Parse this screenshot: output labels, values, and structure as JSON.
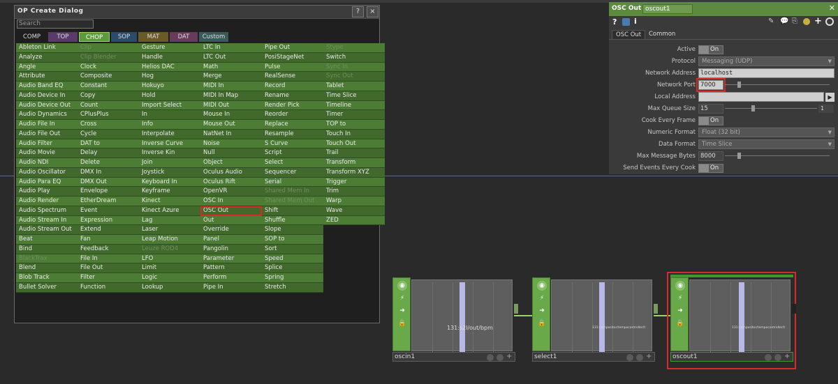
{
  "dialog": {
    "title": "OP Create Dialog",
    "help_label": "?",
    "close_label": "×",
    "search_placeholder": "Search",
    "families": [
      {
        "label": "COMP",
        "color": "#1e1e1e"
      },
      {
        "label": "TOP",
        "color": "#5a3a6a"
      },
      {
        "label": "CHOP",
        "color": "#5c9a3c"
      },
      {
        "label": "SOP",
        "color": "#2c4a6a"
      },
      {
        "label": "MAT",
        "color": "#6a5a28"
      },
      {
        "label": "DAT",
        "color": "#6a3a5a"
      },
      {
        "label": "Custom",
        "color": "#3a5a5a"
      }
    ],
    "selected_family": "CHOP",
    "columns": [
      [
        "Ableton Link",
        "Analyze",
        "Angle",
        "Attribute",
        "Audio Band EQ",
        "Audio Device In",
        "Audio Device Out",
        "Audio Dynamics",
        "Audio File In",
        "Audio File Out",
        "Audio Filter",
        "Audio Movie",
        "Audio NDI",
        "Audio Oscillator",
        "Audio Para EQ",
        "Audio Play",
        "Audio Render",
        "Audio Spectrum",
        "Audio Stream In",
        "Audio Stream Out",
        "Beat",
        "Bind",
        "BlackTrax",
        "Blend",
        "Blob Track",
        "Bullet Solver"
      ],
      [
        "Clip",
        "Clip Blender",
        "Clock",
        "Composite",
        "Constant",
        "Copy",
        "Count",
        "CPlusPlus",
        "Cross",
        "Cycle",
        "DAT to",
        "Delay",
        "Delete",
        "DMX In",
        "DMX Out",
        "Envelope",
        "EtherDream",
        "Event",
        "Expression",
        "Extend",
        "Fan",
        "Feedback",
        "File In",
        "File Out",
        "Filter",
        "Function"
      ],
      [
        "Gesture",
        "Handle",
        "Helios DAC",
        "Hog",
        "Hokuyo",
        "Hold",
        "Import Select",
        "In",
        "Info",
        "Interpolate",
        "Inverse Curve",
        "Inverse Kin",
        "Join",
        "Joystick",
        "Keyboard In",
        "Keyframe",
        "Kinect",
        "Kinect Azure",
        "Lag",
        "Laser",
        "Leap Motion",
        "Leuze ROD4",
        "LFO",
        "Limit",
        "Logic",
        "Lookup"
      ],
      [
        "LTC In",
        "LTC Out",
        "Math",
        "Merge",
        "MIDI In",
        "MIDI In Map",
        "MIDI Out",
        "Mouse In",
        "Mouse Out",
        "NatNet In",
        "Noise",
        "Null",
        "Object",
        "Oculus Audio",
        "Oculus Rift",
        "OpenVR",
        "OSC In",
        "OSC Out",
        "Out",
        "Override",
        "Panel",
        "Pangolin",
        "Parameter",
        "Pattern",
        "Perform",
        "Pipe In"
      ],
      [
        "Pipe Out",
        "PosiStageNet",
        "Pulse",
        "RealSense",
        "Record",
        "Rename",
        "Render Pick",
        "Reorder",
        "Replace",
        "Resample",
        "S Curve",
        "Script",
        "Select",
        "Sequencer",
        "Serial",
        "Shared Mem In",
        "Shared Mem Out",
        "Shift",
        "Shuffle",
        "Slope",
        "SOP to",
        "Sort",
        "Speed",
        "Splice",
        "Spring",
        "Stretch"
      ],
      [
        "Stype",
        "Switch",
        "Sync In",
        "Sync Out",
        "Tablet",
        "Time Slice",
        "Timeline",
        "Timer",
        "TOP to",
        "Touch In",
        "Touch Out",
        "Trail",
        "Transform",
        "Transform XYZ",
        "Trigger",
        "Trim",
        "Warp",
        "Wave",
        "ZED"
      ]
    ],
    "dim_items": [
      "Clip",
      "Clip Blender",
      "Leuze ROD4",
      "BlackTrax",
      "Shared Mem In",
      "Shared Mem Out",
      "Stype",
      "Sync In",
      "Sync Out"
    ],
    "selected_item": "OSC Out"
  },
  "params": {
    "op_type": "OSC Out",
    "op_name": "oscout1",
    "tabs": [
      "OSC Out",
      "Common"
    ],
    "active_tab": "OSC Out",
    "rows": {
      "active": {
        "label": "Active",
        "value": "On"
      },
      "protocol": {
        "label": "Protocol",
        "value": "Messaging (UDP)"
      },
      "network_address": {
        "label": "Network Address",
        "value": "localhost"
      },
      "network_port": {
        "label": "Network Port",
        "value": "7000"
      },
      "local_address": {
        "label": "Local Address",
        "value": ""
      },
      "max_queue_size": {
        "label": "Max Queue Size",
        "value": "15",
        "step": "1"
      },
      "cook_every_frame": {
        "label": "Cook Every Frame",
        "value": "On"
      },
      "numeric_format": {
        "label": "Numeric Format",
        "value": "Float (32 bit)"
      },
      "data_format": {
        "label": "Data Format",
        "value": "Time Slice"
      },
      "max_message_bytes": {
        "label": "Max Message Bytes",
        "value": "8000"
      },
      "send_events_every_cook": {
        "label": "Send Events Every Cook",
        "value": "On"
      }
    }
  },
  "nodes": [
    {
      "name": "oscin1",
      "channel_label": "131:s2l/out/bpm"
    },
    {
      "name": "select1",
      "channel_label": "131:compositor/tempocontroller/t"
    },
    {
      "name": "oscout1",
      "channel_label": "131:compositor/tempocontroller/t"
    }
  ]
}
